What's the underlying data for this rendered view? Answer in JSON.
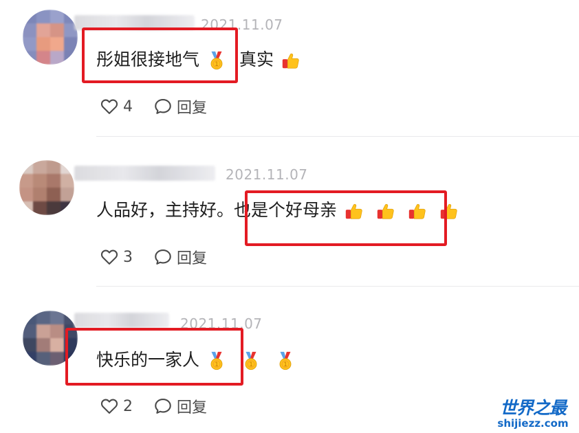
{
  "comments": [
    {
      "timestamp": "2021.11.07",
      "text": "彤姐很接地气",
      "text_after": "真实",
      "emojis_inline": [
        "medal-emoji"
      ],
      "emojis_after": [
        "thumbs-up-emoji"
      ],
      "like_count": "4",
      "reply_label": "回复"
    },
    {
      "timestamp": "2021.11.07",
      "text": "人品好，主持好。",
      "text_after": "也是个好母亲",
      "emojis_inline": [],
      "emojis_after": [
        "thumbs-up-emoji",
        "thumbs-up-emoji",
        "thumbs-up-emoji",
        "thumbs-up-emoji"
      ],
      "like_count": "3",
      "reply_label": "回复"
    },
    {
      "timestamp": "2021.11.07",
      "text": "快乐的一家人",
      "text_after": "",
      "emojis_inline": [
        "medal-emoji"
      ],
      "emojis_after": [
        "medal-emoji",
        "medal-emoji"
      ],
      "like_count": "2",
      "reply_label": "回复"
    }
  ],
  "icons": {
    "like": "heart-outline-icon",
    "reply": "speech-bubble-icon"
  },
  "colors": {
    "highlight_box": "#e31b23",
    "timestamp": "#b4b4b8",
    "text": "#1e1e1e",
    "watermark": "#1269c7"
  },
  "watermark": {
    "title": "世界之最",
    "url": "shijiezz.com"
  }
}
